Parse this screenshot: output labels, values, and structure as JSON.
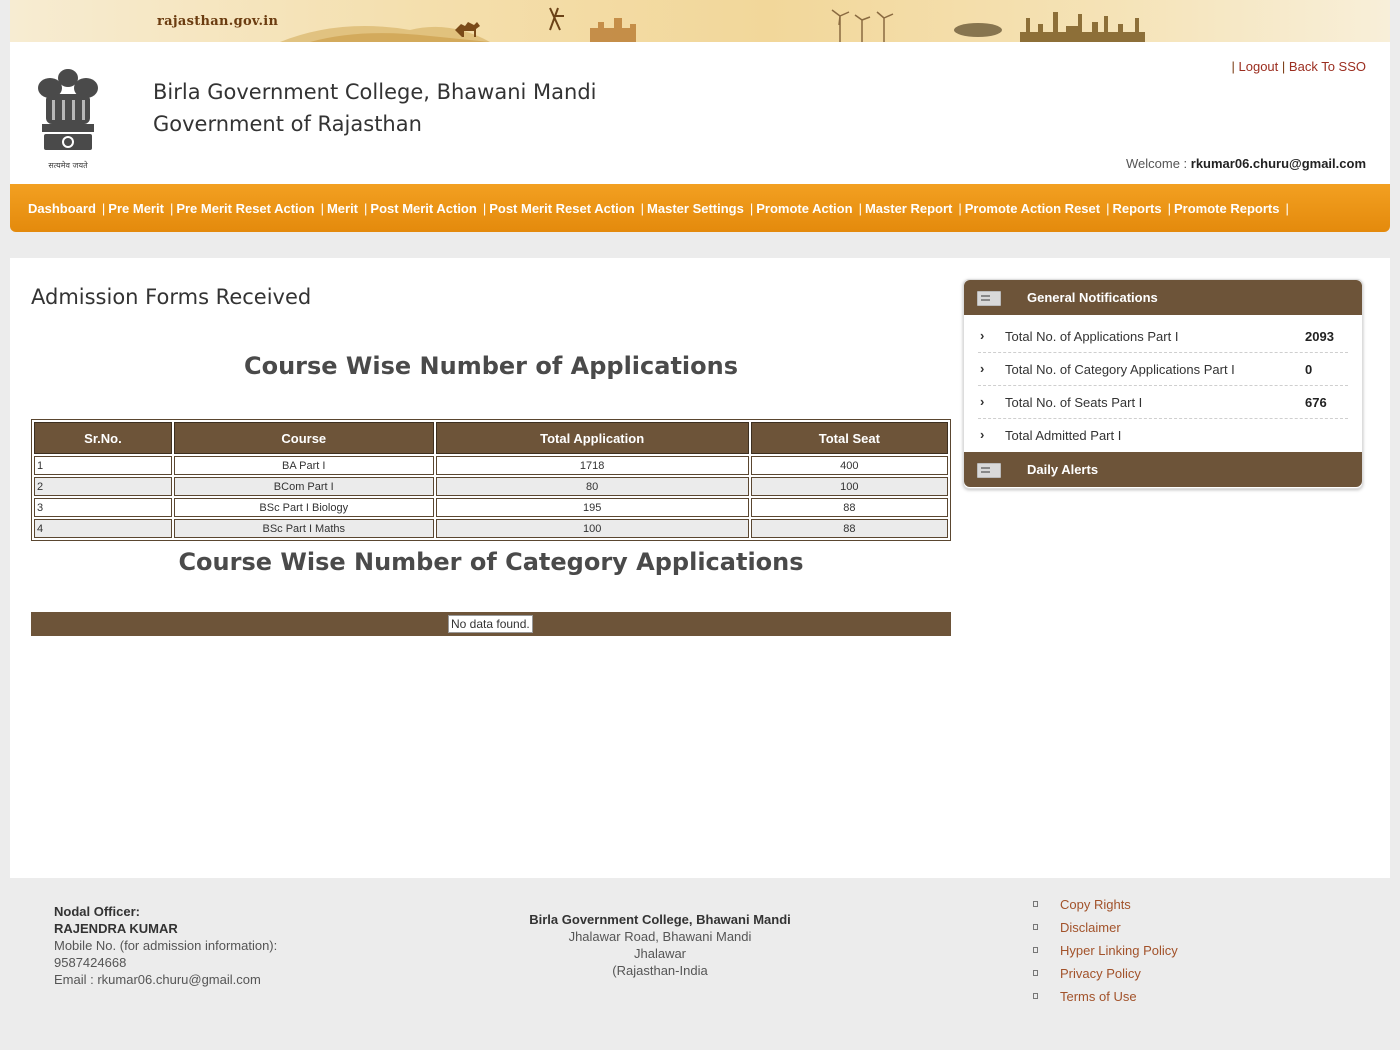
{
  "banner": {
    "site": "rajasthan.gov.in"
  },
  "header": {
    "college": "Birla Government College, Bhawani Mandi",
    "government": "Government of Rajasthan",
    "emblem_caption": "सत्यमेव जयते",
    "links": [
      {
        "label": "Logout"
      },
      {
        "label": "Back To SSO"
      }
    ],
    "separator": "|",
    "welcome_label": "Welcome : ",
    "welcome_user": "rkumar06.churu@gmail.com"
  },
  "menu": {
    "items": [
      "Dashboard",
      "Pre Merit",
      "Pre Merit Reset Action",
      "Merit",
      "Post Merit Action",
      "Post Merit Reset Action",
      "Master Settings",
      "Promote Action",
      "Master Report",
      "Promote Action Reset",
      "Reports",
      "Promote Reports"
    ],
    "separator": "|"
  },
  "main": {
    "page_title": "Admission Forms Received",
    "section1_title": "Course Wise Number of Applications",
    "table": {
      "headers": [
        "Sr.No.",
        "Course",
        "Total Application",
        "Total Seat"
      ],
      "rows": [
        [
          "1",
          "BA Part I",
          "1718",
          "400"
        ],
        [
          "2",
          "BCom Part I",
          "80",
          "100"
        ],
        [
          "3",
          "BSc Part I Biology",
          "195",
          "88"
        ],
        [
          "4",
          "BSc Part I Maths",
          "100",
          "88"
        ]
      ]
    },
    "section2_title": "Course Wise Number of Category Applications",
    "no_data": "No data found."
  },
  "notifications": {
    "general_title": "General Notifications",
    "items": [
      {
        "label": "Total No. of Applications Part I",
        "value": "2093"
      },
      {
        "label": "Total No. of Category Applications Part I",
        "value": "0"
      },
      {
        "label": "Total No. of Seats Part I",
        "value": "676"
      },
      {
        "label": "Total Admitted Part I",
        "value": ""
      }
    ],
    "alerts_title": "Daily Alerts",
    "arrow": "›"
  },
  "footer": {
    "nodal_label": "Nodal Officer:",
    "nodal_name": "RAJENDRA KUMAR",
    "mobile": "Mobile No. (for admission information): 9587424668",
    "email": "Email : rkumar06.churu@gmail.com",
    "address": {
      "name": "Birla Government College, Bhawani Mandi",
      "line1": "Jhalawar Road, Bhawani Mandi",
      "line2": "Jhalawar",
      "line3": "(Rajasthan-India"
    },
    "links": [
      "Copy Rights",
      "Disclaimer",
      "Hyper Linking Policy",
      "Privacy Policy",
      "Terms of Use"
    ]
  },
  "colors": {
    "menu_orange": "#e9900f",
    "table_brown": "#6d5439",
    "link_red": "#9b2d1f",
    "banner_tan": "#f2d79a"
  }
}
